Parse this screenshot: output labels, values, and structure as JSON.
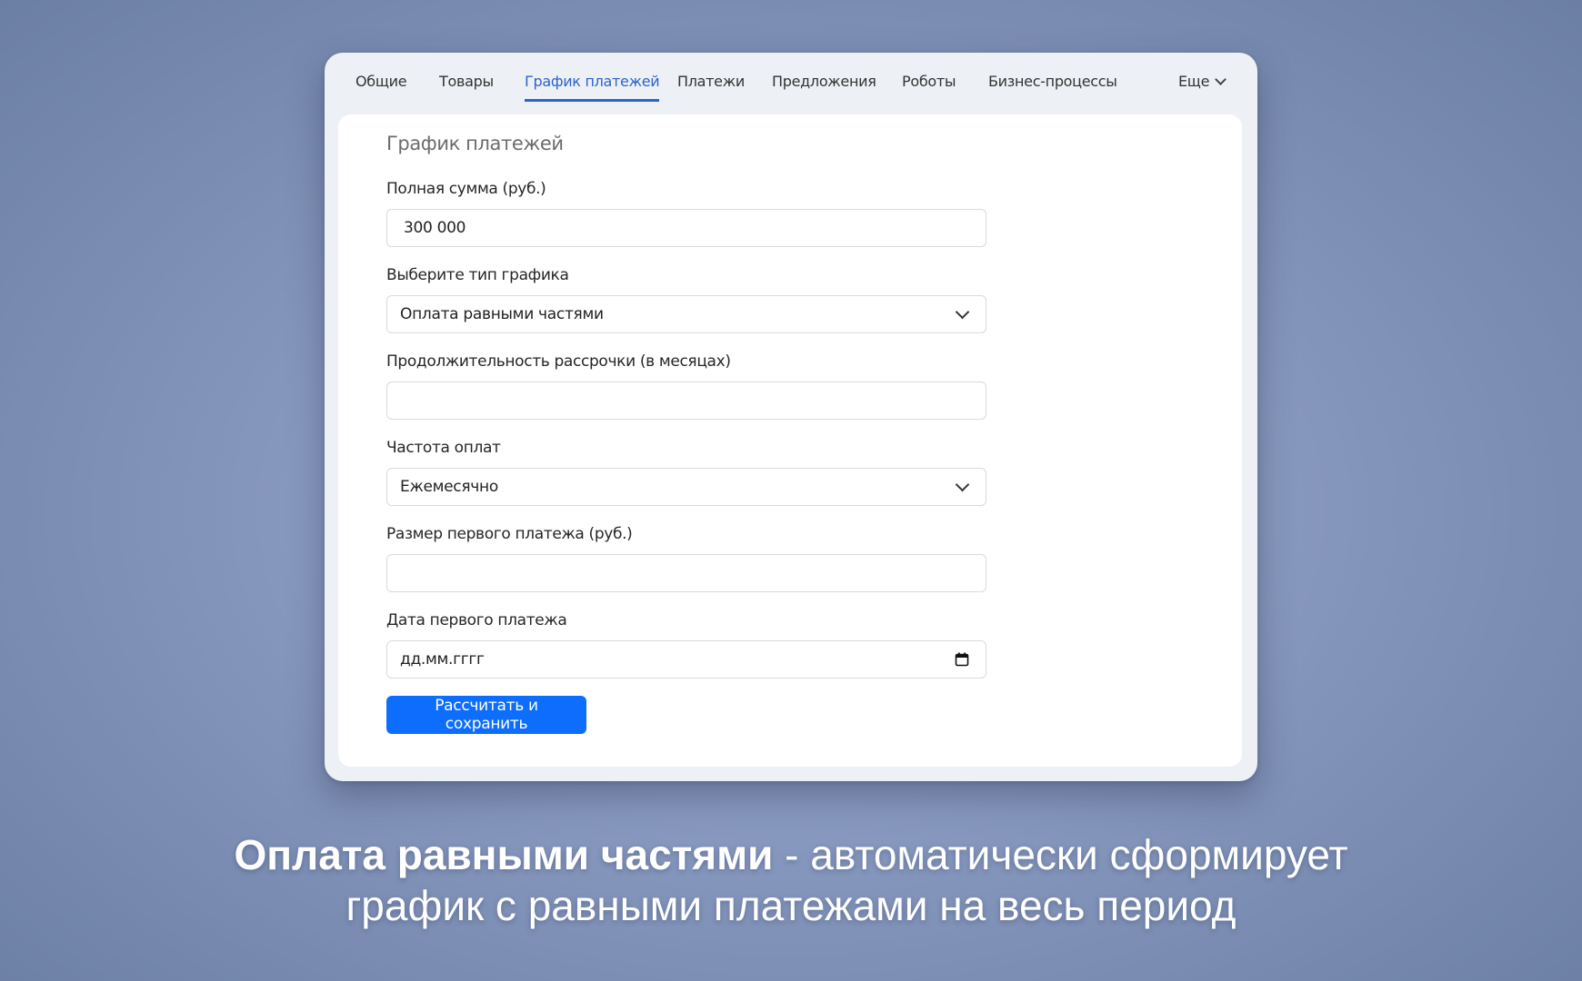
{
  "tabs": {
    "items": [
      {
        "label": "Общие"
      },
      {
        "label": "Товары"
      },
      {
        "label": "График платежей",
        "active": true
      },
      {
        "label": "Платежи"
      },
      {
        "label": "Предложения"
      },
      {
        "label": "Роботы"
      },
      {
        "label": "Бизнес-процессы"
      }
    ],
    "more_label": "Еще"
  },
  "form": {
    "title": "График платежей",
    "total_amount": {
      "label": "Полная сумма (руб.)",
      "value": "300 000"
    },
    "schedule_type": {
      "label": "Выберите тип графика",
      "value": "Оплата равными частями"
    },
    "duration": {
      "label": "Продолжительность рассрочки (в месяцах)",
      "value": ""
    },
    "frequency": {
      "label": "Частота оплат",
      "value": "Ежемесячно"
    },
    "first_payment_size": {
      "label": "Размер первого платежа (руб.)",
      "value": ""
    },
    "first_payment_date": {
      "label": "Дата первого платежа",
      "placeholder": "дд.мм.гггг"
    },
    "submit_label": "Рассчитать и сохранить"
  },
  "caption": {
    "bold": "Оплата равными частями",
    "rest_line1": " - автоматически сформирует",
    "line2": "график с равными платежами на весь период"
  },
  "colors": {
    "accent": "#2e62cc",
    "button": "#0d6efd"
  }
}
